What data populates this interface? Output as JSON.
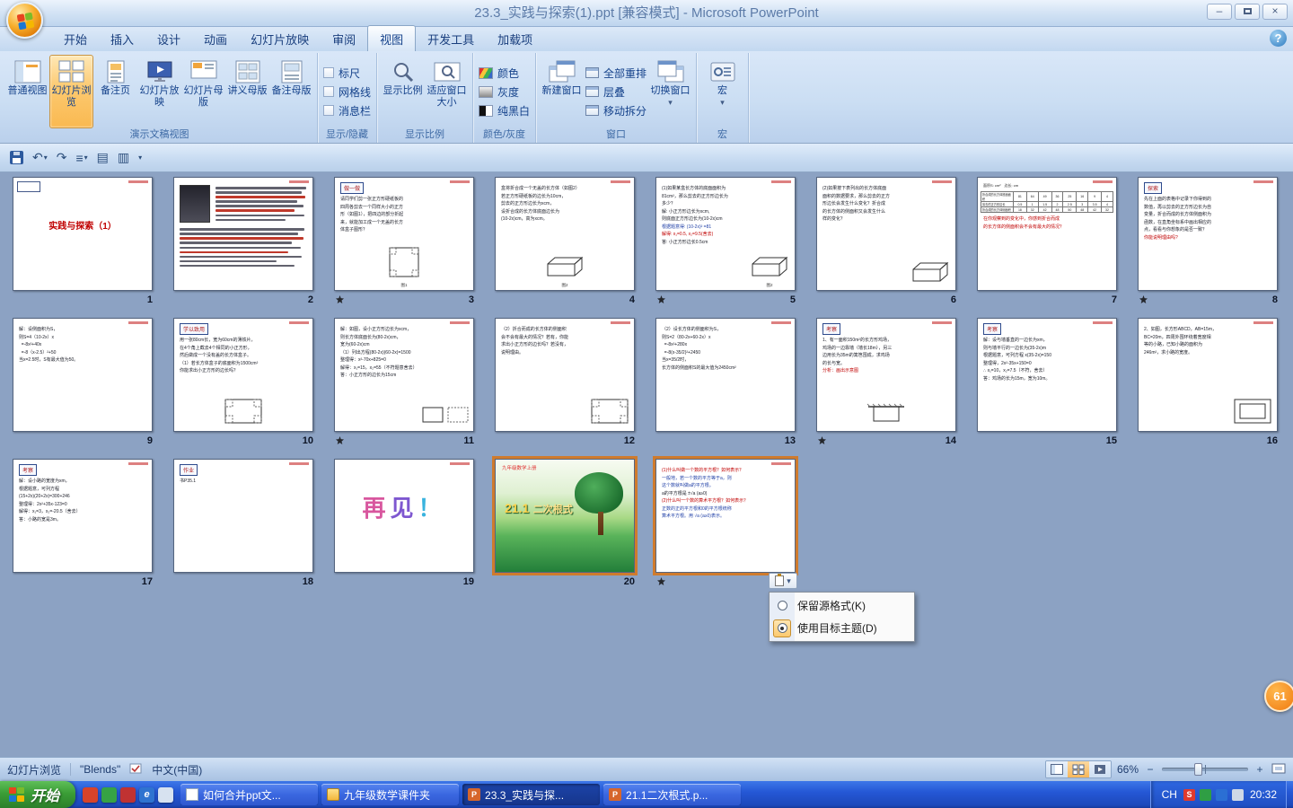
{
  "window": {
    "title": "23.3_实践与探索(1).ppt [兼容模式] - Microsoft PowerPoint",
    "minimize_glyph": "–",
    "close_glyph": "×"
  },
  "tabs": [
    {
      "label": "开始"
    },
    {
      "label": "插入"
    },
    {
      "label": "设计"
    },
    {
      "label": "动画"
    },
    {
      "label": "幻灯片放映"
    },
    {
      "label": "审阅"
    },
    {
      "label": "视图",
      "active": true
    },
    {
      "label": "开发工具"
    },
    {
      "label": "加载项"
    }
  ],
  "ribbon": {
    "help_label": "?",
    "views": {
      "label": "演示文稿视图",
      "active": 1,
      "buttons": [
        "普通视图",
        "幻灯片浏览",
        "备注页",
        "幻灯片放映",
        "幻灯片母版",
        "讲义母版",
        "备注母版"
      ]
    },
    "show_hide": {
      "label": "显示/隐藏",
      "items": [
        {
          "label": "标尺",
          "checked": false
        },
        {
          "label": "网格线",
          "checked": false
        },
        {
          "label": "消息栏",
          "checked": false
        }
      ]
    },
    "zoom": {
      "label": "显示比例",
      "buttons": [
        "显示比例",
        "适应窗口大小"
      ]
    },
    "color": {
      "label": "颜色/灰度",
      "buttons": [
        "颜色",
        "灰度",
        "纯黑白"
      ]
    },
    "window": {
      "label": "窗口",
      "big1": "新建窗口",
      "small": [
        "全部重排",
        "层叠",
        "移动拆分"
      ],
      "big2": "切换窗口"
    },
    "macro": {
      "label": "宏",
      "button": "宏"
    }
  },
  "toolbar": {
    "icons": [
      "save",
      "undo",
      "redo",
      "bullet-list",
      "layout-grid",
      "layout-table",
      "overflow"
    ]
  },
  "statusbar": {
    "view_label": "幻灯片浏览",
    "theme": "\"Blends\"",
    "language": "中文(中国)",
    "zoom_value": "66%"
  },
  "paste_menu": {
    "items": [
      {
        "label": "保留源格式(K)",
        "selected": false
      },
      {
        "label": "使用目标主题(D)",
        "selected": true
      }
    ]
  },
  "taskbar": {
    "start_label": "开始",
    "tasks": [
      {
        "label": "如何合并ppt文...",
        "icon": "page"
      },
      {
        "label": "九年级数学课件夹",
        "icon": "folder"
      },
      {
        "label": "23.3_实践与探...",
        "icon": "ppt",
        "active": true
      },
      {
        "label": "21.1二次根式.p...",
        "icon": "ppt"
      }
    ],
    "quick_launch": [
      {
        "name": "sogou-icon",
        "color": "#d8432a"
      },
      {
        "name": "media-player-icon",
        "color": "#36a345"
      },
      {
        "name": "reader-icon",
        "color": "#c03232"
      },
      {
        "name": "internet-explorer-icon",
        "color": "#2f73d0",
        "glyph": "e"
      },
      {
        "name": "show-desktop-icon",
        "color": "#d7e2f0"
      }
    ],
    "tray": {
      "input_indicator": "CH",
      "time": "20:32",
      "icons": [
        {
          "name": "sogou-tray-icon",
          "color": "#e03a2f",
          "glyph": "S"
        },
        {
          "name": "security-tray-icon",
          "color": "#2f9e44",
          "glyph": ""
        },
        {
          "name": "messenger-tray-icon",
          "color": "#2b6fd4",
          "glyph": ""
        },
        {
          "name": "volume-icon",
          "color": "#cfd8e6",
          "glyph": ""
        }
      ]
    }
  },
  "badge": {
    "text": "61"
  },
  "slides": [
    {
      "n": 1,
      "type": "title",
      "lines": [
        {
          "t": "实践与探索（1）",
          "c": "r"
        }
      ]
    },
    {
      "n": 2,
      "type": "bio",
      "lines": []
    },
    {
      "n": 3,
      "type": "text",
      "header": "做一做",
      "transition": true,
      "diagram": "square",
      "dpos": "c",
      "dcap": "图1",
      "lines": [
        "请同学们剪一张正方形硬纸板的",
        "四周各剪去一个同样大小的正方",
        "形（如图1），把四边的部分折起",
        "来，就能加工成一个无盖的长方",
        "体盒子图形？"
      ]
    },
    {
      "n": 4,
      "type": "text",
      "diagram": "box3d",
      "dpos": "c",
      "dcap": "图2",
      "lines": [
        "盒将折合成一个无盖的长方体（如图2）",
        "若正方形硬纸板的边长为10cm，",
        "剪去的正方形边长为xcm，",
        "设折合成的长方体底面边长为",
        "(10-2x)cm，高为xcm。"
      ]
    },
    {
      "n": 5,
      "type": "text",
      "transition": true,
      "diagram": "box3d",
      "dpos": "r",
      "dcap": "图2",
      "lines": [
        "(1)如果某盒长方体的底面面积为",
        "81cm²，那么剪去的正方形边长为",
        "多少？",
        "解: 小正方形边长为xcm,",
        "则底面正方形边长为(10-2x)cm",
        {
          "t": "根据题意得: (10-2x)² =81",
          "c": "b"
        },
        {
          "t": "解得: x₁=0.5, x₂=9.5(舍去)",
          "c": "r"
        },
        "答: 小正方形边长0.5cm"
      ]
    },
    {
      "n": 6,
      "type": "text",
      "diagram": "box3d",
      "dpos": "r",
      "lines": [
        "(2)如果按下表列出的长方体底面",
        "面积的数据要求，那么剪去的正方",
        "形边长会发生什么变化？折合成",
        "的长方体的侧面积又会发生什么",
        "样的变化？"
      ]
    },
    {
      "n": 7,
      "type": "text",
      "table_caption": "面积S: cm²　边长: cm",
      "table": {
        "rows": [
          {
            "label": "折合成的长方体底面面积",
            "values": [
              "81",
              "64",
              "49",
              "36",
              "25",
              "16",
              "9",
              "4"
            ]
          },
          {
            "label": "剪去的正方形边长",
            "values": [
              "0.5",
              "1",
              "1.5",
              "2",
              "2.5",
              "3",
              "3.5",
              "4"
            ]
          },
          {
            "label": "折合成的长方体侧面积",
            "values": [
              "18",
              "32",
              "42",
              "48",
              "50",
              "48",
              "42",
              "32"
            ]
          }
        ]
      },
      "lines": [
        {
          "t": "在你观察到的变化中，你感到折合而成",
          "c": "r"
        },
        {
          "t": "的长方体的侧面积会不会有最大的情况？",
          "c": "r"
        }
      ]
    },
    {
      "n": 8,
      "type": "text",
      "header": "探索",
      "transition": true,
      "lines": [
        "先在上面的表格中记录下你得到的",
        "数值，再以剪去的正方形边长为自",
        "变量，折合而成的长方体侧面积为",
        "函数，在直角坐标系中画出相应的",
        "点，看看与你想象的是否一致？",
        {
          "t": "你能说明理由吗?",
          "c": "r"
        }
      ]
    },
    {
      "n": 9,
      "type": "text",
      "lines": [
        "解：设侧面积为S，",
        "则S=4（10-2x）x",
        "  =-8x²+40x",
        "  =-8（x-2.5）²+50",
        "当x=2.5时，S有最大值为50。"
      ]
    },
    {
      "n": 10,
      "type": "text",
      "header": "学以致用",
      "diagram": "dashedrect",
      "dpos": "c",
      "lines": [
        "用一张80cm长，宽为60cm的薄铁片，",
        "在4个角上截去4个相同的小正方形，",
        "然后做成一个没有盖的长方体盒子。",
        "（1）若长方体盒子的底面积为1500cm²",
        "你能求出小正方形的边长吗？"
      ]
    },
    {
      "n": 11,
      "type": "text",
      "transition": true,
      "diagram": "twomini",
      "dpos": "r",
      "lines": [
        "解：如图，设小正方形边长为xcm，",
        "则长方体底面长为(80-2x)cm，",
        "宽为(60-2x)cm",
        "（1）列出方程(80-2x)(60-2x)=1500",
        "整理得：x²-70x+825=0",
        "解得：x₁=15，x₂=55（不符题意舍去）",
        "答：小正方形的边长为15cm"
      ]
    },
    {
      "n": 12,
      "type": "text",
      "diagram": "dashedrect",
      "dpos": "r",
      "lines": [
        "（2）折合而成的长方体的侧面积",
        "会不会有最大的情况？若有，你能",
        "求出小正方形的边长吗？若没有，",
        "说明理由。"
      ]
    },
    {
      "n": 13,
      "type": "text",
      "lines": [
        "（2）设长方体的侧面积为S，",
        "则S=2（80-2x+60-2x）x",
        "  =-8x²+280x",
        "  =-8(x-35/2)²+2450",
        "当x=35/2时，",
        "长方体的侧面积S的最大值为2450cm²"
      ]
    },
    {
      "n": 14,
      "type": "text",
      "header": "考察",
      "transition": true,
      "diagram": "wall",
      "dpos": "c",
      "lines": [
        "1、有一面积150m²的长方形鸡场，",
        "鸡场的一边靠墙（墙长18m），另三",
        "边用长为35m的篱笆围成，求鸡场",
        "的长与宽。",
        {
          "t": "分析：画出示意图",
          "c": "r"
        }
      ]
    },
    {
      "n": 15,
      "type": "text",
      "header": "考察",
      "lines": [
        "解：设与墙垂直的一边长为xm，",
        "则与墙平行的一边长为(35-2x)m",
        "根据题意，可列方程 x(35-2x)=150",
        "整理得，2x²-35x+150=0",
        "∴ x₁=10，x₂=7.5（不符，舍去）",
        "答：鸡场的长为15m，宽为10m。"
      ]
    },
    {
      "n": 16,
      "type": "text",
      "diagram": "nestedrect",
      "dpos": "r",
      "lines": [
        "2、如图，长方形ABCD，AB=15m，",
        "BC=20m，四周外围环绕着宽度相",
        "等的小路，已知小路的面积为",
        "246m²，求小路的宽度。"
      ]
    },
    {
      "n": 17,
      "type": "text",
      "header": "考察",
      "lines": [
        "解：设小路的宽度为xm，",
        "根据题意，可列方程",
        "(15+2x)(20+2x)=300+246",
        "整理得：2x²+35x-123=0",
        "解得：x₁=3，x₂=-20.5（舍去）",
        "答：小路的宽是3m。"
      ]
    },
    {
      "n": 18,
      "type": "text",
      "header": "作业",
      "lines": [
        "书P35.1"
      ]
    },
    {
      "n": 19,
      "type": "farewell",
      "lines": [
        "再见！"
      ]
    },
    {
      "n": 20,
      "type": "nature",
      "selected": true,
      "lines": [
        {
          "t": "九年级数学上册",
          "c": "r"
        },
        {
          "t": "21.1",
          "c": "num"
        },
        {
          "t": "二次根式",
          "c": "title"
        }
      ]
    },
    {
      "n": 21,
      "type": "text",
      "selected": true,
      "transition": true,
      "lines": [
        {
          "t": "(1)什么叫做一个数的平方根？如何表示？",
          "c": "r"
        },
        {
          "t": "一般地，若一个数的平方等于a，则",
          "c": "b"
        },
        {
          "t": "这个数就叫做a的平方根。",
          "c": "b"
        },
        {
          "t": "a的平方根是 ±√a (a≥0)",
          "c": "k"
        },
        {
          "t": "(2)什么叫一个数的算术平方根？如何表示？",
          "c": "r"
        },
        {
          "t": "正数的正的平方根和0的平方根统称",
          "c": "b"
        },
        {
          "t": "算术平方根。用 √a (a≥0)表示。",
          "c": "b"
        }
      ]
    }
  ]
}
